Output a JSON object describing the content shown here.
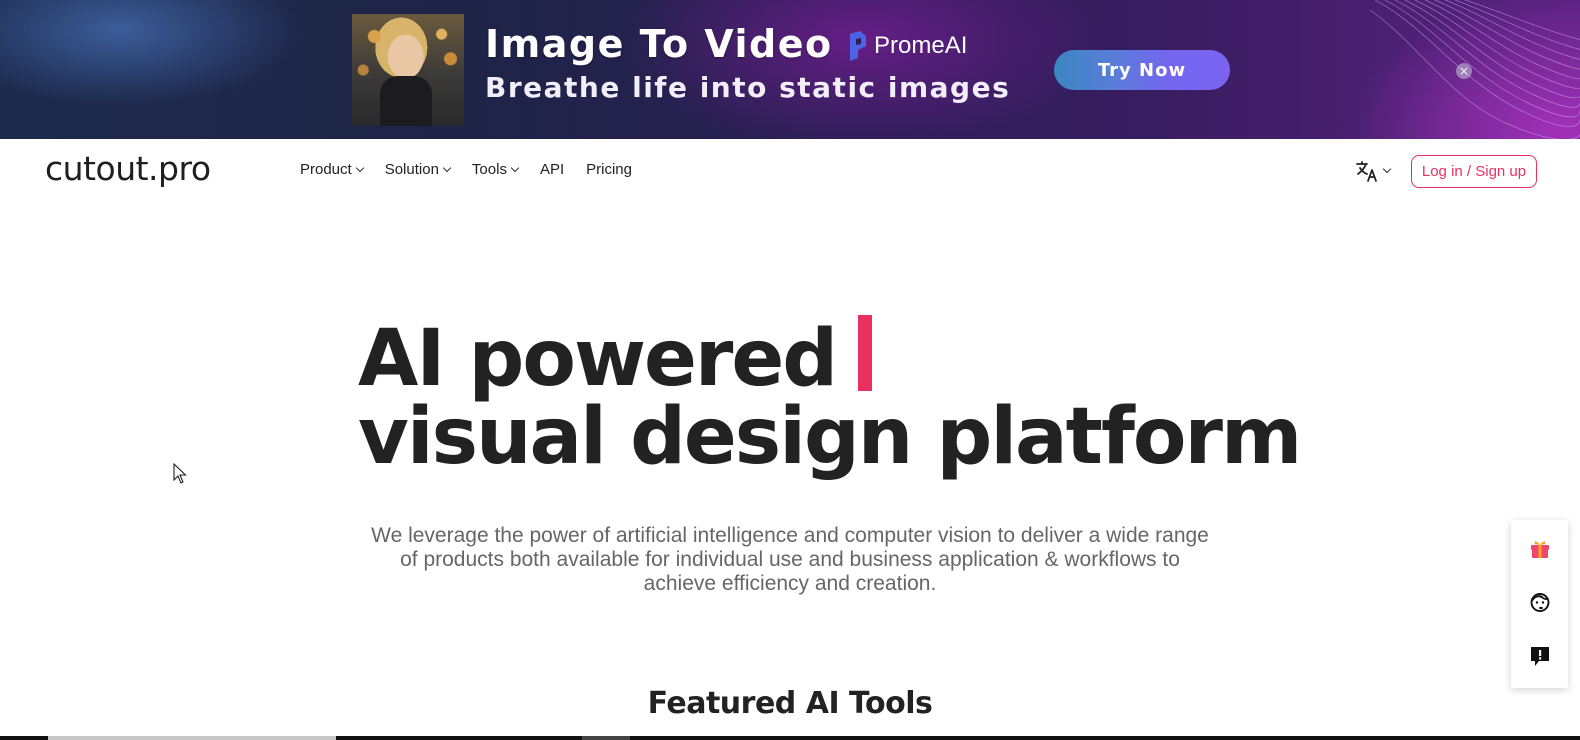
{
  "ad": {
    "title": "Image To Video",
    "brand": "PromeAI",
    "subtitle": "Breathe life into static images",
    "cta_label": "Try Now",
    "close_label": "×",
    "colors": {
      "cta_start": "#3a86c2",
      "cta_end": "#7a64f0",
      "brand_mark": "#5b7cf0"
    }
  },
  "nav": {
    "logo": "cutout.pro",
    "items": [
      {
        "label": "Product",
        "has_dropdown": true,
        "icon": "chevron-down-icon"
      },
      {
        "label": "Solution",
        "has_dropdown": true,
        "icon": "chevron-down-icon"
      },
      {
        "label": "Tools",
        "has_dropdown": true,
        "icon": "chevron-down-icon"
      },
      {
        "label": "API",
        "has_dropdown": false
      },
      {
        "label": "Pricing",
        "has_dropdown": false
      }
    ],
    "language_icon": "translate-icon",
    "login_label": "Log in / Sign up",
    "accent": "#e8315e"
  },
  "hero": {
    "line1": "AI powered",
    "line2": "visual design platform",
    "description": "We leverage the power of artificial intelligence and computer vision to deliver a wide range of products both available for individual use and business application & workflows to achieve efficiency and creation.",
    "caret_color": "#e8315e"
  },
  "featured": {
    "title": "Featured AI Tools"
  },
  "side_toolbar": {
    "items": [
      {
        "icon": "gift-icon",
        "label": "Gift"
      },
      {
        "icon": "customer-support-icon",
        "label": "Support"
      },
      {
        "icon": "feedback-icon",
        "label": "Feedback"
      }
    ]
  }
}
